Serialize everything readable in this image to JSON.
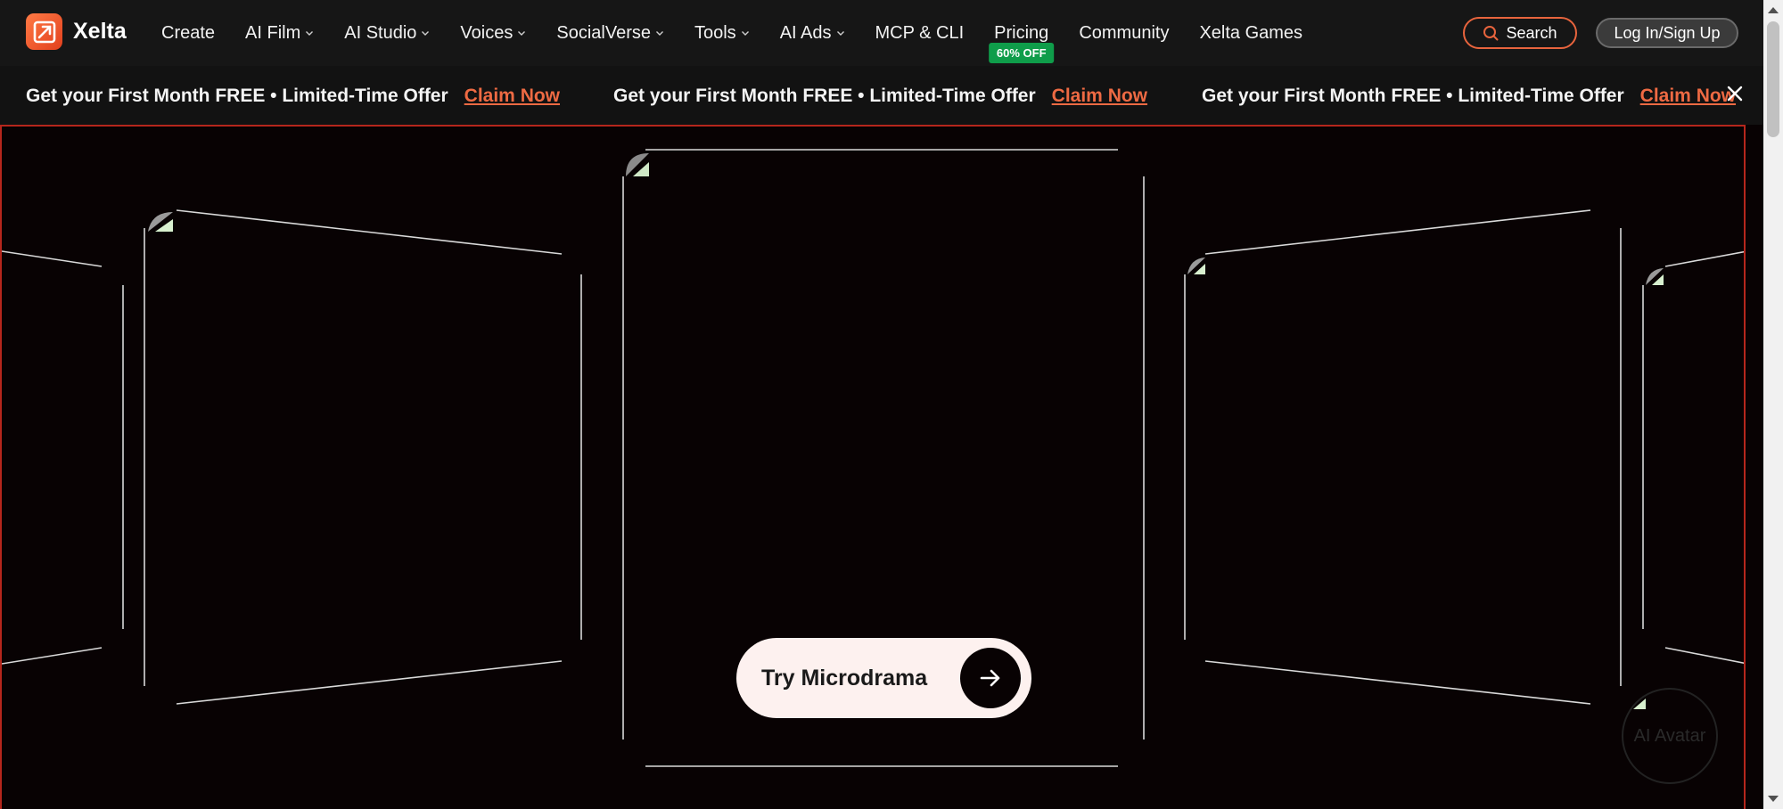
{
  "brand": {
    "name": "Xelta",
    "accent": "#e8643d",
    "badge_color": "#0f9d4a"
  },
  "nav": {
    "items": [
      {
        "label": "Create",
        "dropdown": false
      },
      {
        "label": "AI Film",
        "dropdown": true
      },
      {
        "label": "AI Studio",
        "dropdown": true
      },
      {
        "label": "Voices",
        "dropdown": true
      },
      {
        "label": "SocialVerse",
        "dropdown": true
      },
      {
        "label": "Tools",
        "dropdown": true
      },
      {
        "label": "AI Ads",
        "dropdown": true
      },
      {
        "label": "MCP & CLI",
        "dropdown": false
      },
      {
        "label": "Pricing",
        "dropdown": false,
        "badge": "60% OFF"
      },
      {
        "label": "Community",
        "dropdown": false
      },
      {
        "label": "Xelta Games",
        "dropdown": false
      }
    ],
    "search_label": "Search",
    "login_label": "Log In/Sign Up"
  },
  "promo": {
    "text": "Get your First Month FREE • Limited-Time Offer",
    "claim": "Claim Now"
  },
  "hero": {
    "cta_label": "Try Microdrama",
    "floating_label": "AI Avatar"
  }
}
